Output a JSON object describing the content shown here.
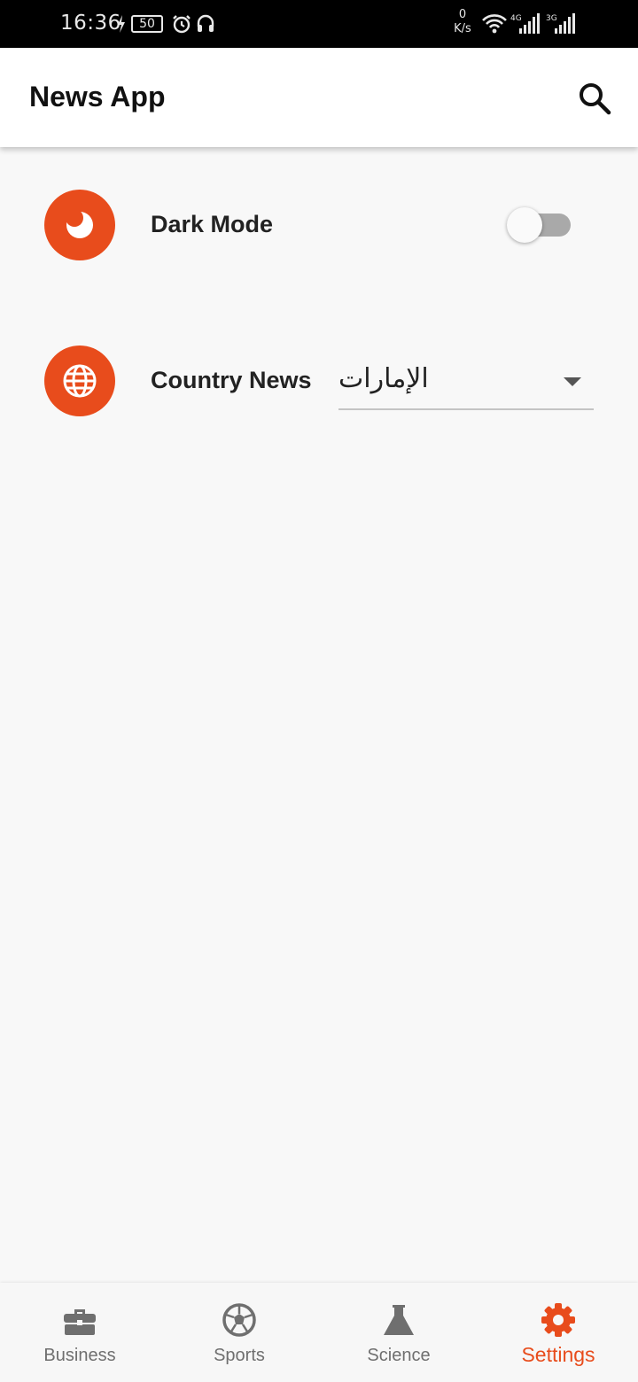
{
  "status_bar": {
    "time": "16:36",
    "battery": "50",
    "net_speed_value": "0",
    "net_speed_unit": "K/s",
    "signal1": "4G",
    "signal2": "3G"
  },
  "app_bar": {
    "title": "News App",
    "search_icon": "search-icon"
  },
  "settings": {
    "dark_mode": {
      "label": "Dark Mode",
      "icon": "moon-icon",
      "enabled": false
    },
    "country_news": {
      "label": "Country News",
      "icon": "globe-icon",
      "selected": "الإمارات"
    }
  },
  "bottom_nav": {
    "items": [
      {
        "label": "Business",
        "icon": "briefcase-icon",
        "active": false
      },
      {
        "label": "Sports",
        "icon": "soccer-ball-icon",
        "active": false
      },
      {
        "label": "Science",
        "icon": "flask-icon",
        "active": false
      },
      {
        "label": "Settings",
        "icon": "gear-icon",
        "active": true
      }
    ]
  },
  "colors": {
    "accent": "#e84c1c",
    "inactive": "#6f6f6f",
    "background": "#f8f8f8",
    "status_bar": "#000000"
  }
}
